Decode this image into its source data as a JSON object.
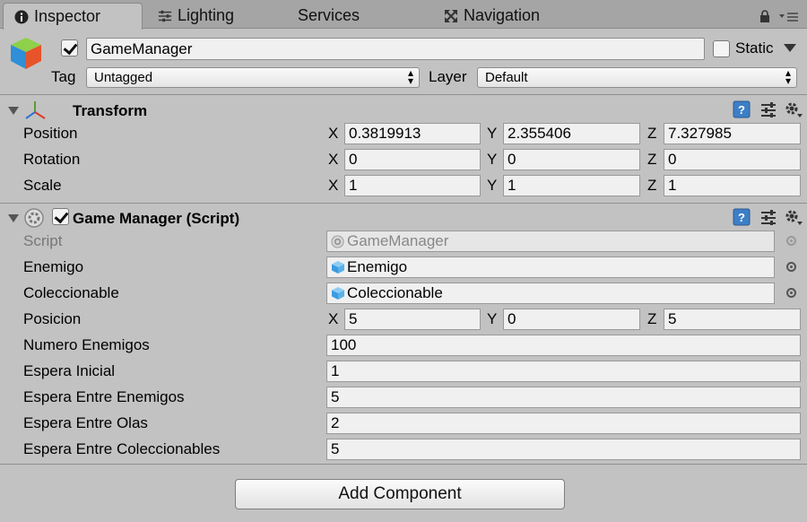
{
  "tabs": [
    {
      "label": "Inspector",
      "icon": "info-icon",
      "active": true
    },
    {
      "label": "Lighting",
      "icon": "lighting-icon"
    },
    {
      "label": "Services",
      "icon": ""
    },
    {
      "label": "Navigation",
      "icon": "navigation-icon"
    }
  ],
  "header": {
    "object_name": "GameManager",
    "active": true,
    "static_label": "Static",
    "static_checked": false,
    "tag_label": "Tag",
    "tag_value": "Untagged",
    "layer_label": "Layer",
    "layer_value": "Default"
  },
  "transform": {
    "title": "Transform",
    "rows": [
      {
        "label": "Position",
        "x": "0.3819913",
        "y": "2.355406",
        "z": "7.327985"
      },
      {
        "label": "Rotation",
        "x": "0",
        "y": "0",
        "z": "0"
      },
      {
        "label": "Scale",
        "x": "1",
        "y": "1",
        "z": "1"
      }
    ]
  },
  "game_manager": {
    "title": "Game Manager (Script)",
    "enabled": true,
    "script_label": "Script",
    "script_value": "GameManager",
    "enemigo_label": "Enemigo",
    "enemigo_value": "Enemigo",
    "coleccionable_label": "Coleccionable",
    "coleccionable_value": "Coleccionable",
    "posicion_label": "Posicion",
    "posicion": {
      "x": "5",
      "y": "0",
      "z": "5"
    },
    "fields": [
      {
        "label": "Numero Enemigos",
        "value": "100"
      },
      {
        "label": "Espera Inicial",
        "value": "1"
      },
      {
        "label": "Espera Entre Enemigos",
        "value": "5"
      },
      {
        "label": "Espera Entre Olas",
        "value": "2"
      },
      {
        "label": "Espera Entre Coleccionables",
        "value": "5"
      }
    ]
  },
  "axis_labels": {
    "x": "X",
    "y": "Y",
    "z": "Z"
  },
  "add_component_label": "Add Component"
}
